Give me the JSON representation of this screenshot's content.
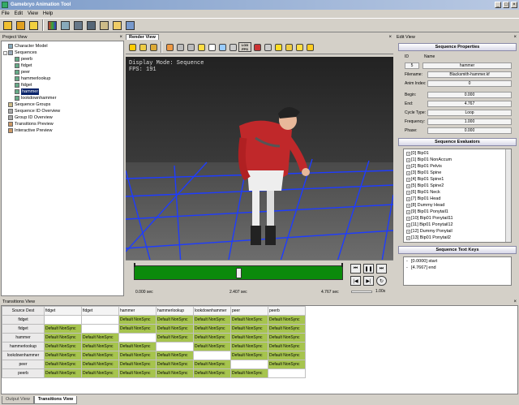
{
  "app": {
    "title": "Gamebryo Animation Tool"
  },
  "menu": [
    "File",
    "Edit",
    "View",
    "Help"
  ],
  "toolbar": {
    "icons": [
      "open-icon",
      "refresh-icon",
      "user-icon",
      "color-icon",
      "model-icon",
      "sequence-icon",
      "transition-icon",
      "group-icon",
      "options-icon",
      "view-icon"
    ]
  },
  "project_view": {
    "title": "Project View",
    "tree": [
      {
        "label": "Character Model",
        "level": 0,
        "icon": "model-icon"
      },
      {
        "label": "Sequences",
        "level": 0,
        "icon": "folder-icon"
      },
      {
        "label": "peerb",
        "level": 1,
        "icon": "sequence-icon"
      },
      {
        "label": "fidget",
        "level": 1,
        "icon": "sequence-icon"
      },
      {
        "label": "peer",
        "level": 1,
        "icon": "sequence-icon"
      },
      {
        "label": "hammerlookup",
        "level": 1,
        "icon": "sequence-icon"
      },
      {
        "label": "fidget",
        "level": 1,
        "icon": "sequence-icon"
      },
      {
        "label": "hammer",
        "level": 1,
        "icon": "sequence-icon",
        "selected": true
      },
      {
        "label": "lookdownhammer",
        "level": 1,
        "icon": "sequence-icon"
      },
      {
        "label": "Sequence Groups",
        "level": 0,
        "icon": "group-icon"
      },
      {
        "label": "Sequence ID Overview",
        "level": 0,
        "icon": "overview-icon"
      },
      {
        "label": "Group ID Overview",
        "level": 0,
        "icon": "overview-icon"
      },
      {
        "label": "Transitions Preview",
        "level": 0,
        "icon": "preview-icon"
      },
      {
        "label": "Interactive Preview",
        "level": 0,
        "icon": "preview-icon"
      }
    ]
  },
  "render_view": {
    "tab": "Render View",
    "overlay_line1": "Display Mode: Sequence",
    "overlay_line2": "FPS: 191",
    "fps_button": "LOD FPS",
    "timeline": {
      "start": "0.000 sec",
      "current": "2.407 sec",
      "end": "4.767 sec",
      "speed": "1.00x",
      "progress": 0.505
    }
  },
  "edit_view": {
    "title": "Edit View",
    "properties_header": "Sequence Properties",
    "id_label": "ID",
    "id_value": "5",
    "name_label": "Name",
    "name_value": "hammer",
    "filename_label": "Filename:",
    "filename_value": "Blacksmith-hammer.kf",
    "anim_index_label": "Anim Index:",
    "anim_index_value": "0",
    "begin_label": "Begin:",
    "begin_value": "0.000",
    "end_label": "End:",
    "end_value": "4.767",
    "cycle_label": "Cycle Type:",
    "cycle_value": "Loop",
    "freq_label": "Frequency:",
    "freq_value": "1.000",
    "phase_label": "Phase:",
    "phase_value": "0.000",
    "evaluators_header": "Sequence Evaluators",
    "evaluators": [
      "[0] Bip01",
      "[1] Bip01 NonAccum",
      "[2] Bip01 Pelvis",
      "[3] Bip01 Spine",
      "[4] Bip01 Spine1",
      "[5] Bip01 Spine2",
      "[6] Bip01 Neck",
      "[7] Bip01 Head",
      "[8] Dummy Head",
      "[9] Bip01 Ponytail1",
      "[10] Bip01 Ponytail11",
      "[11] Bip01 Ponytail12",
      "[12] Dummy Ponytail",
      "[13] Bip01 Ponytail2"
    ],
    "textkeys_header": "Sequence Text Keys",
    "textkeys": [
      "[0.0000] start",
      "[4.7667] end"
    ]
  },
  "transitions": {
    "title": "Transitions View",
    "corner_left": "Source",
    "corner_right": "Dest",
    "columns": [
      "fidget",
      "fidget",
      "hammer",
      "hammerlookup",
      "lookdownhammer",
      "peer",
      "peerb"
    ],
    "rows": [
      {
        "label": "fidget",
        "cells": [
          "",
          "",
          "Default NonSync",
          "Default NonSync",
          "Default NonSync",
          "Default NonSync",
          "Default NonSync"
        ]
      },
      {
        "label": "fidget",
        "cells": [
          "Default NonSync",
          "",
          "Default NonSync",
          "Default NonSync",
          "Default NonSync",
          "Default NonSync",
          "Default NonSync"
        ]
      },
      {
        "label": "hammer",
        "cells": [
          "Default NonSync",
          "Default NonSync",
          "",
          "Default NonSync",
          "Default NonSync",
          "Default NonSync",
          "Default NonSync"
        ]
      },
      {
        "label": "hammerlookup",
        "cells": [
          "Default NonSync",
          "Default NonSync",
          "Default NonSync",
          "",
          "Default NonSync",
          "Default NonSync",
          "Default NonSync"
        ]
      },
      {
        "label": "lookdownhammer",
        "cells": [
          "Default NonSync",
          "Default NonSync",
          "Default NonSync",
          "Default NonSync",
          "",
          "Default NonSync",
          "Default NonSync"
        ]
      },
      {
        "label": "peer",
        "cells": [
          "Default NonSync",
          "Default NonSync",
          "Default NonSync",
          "Default NonSync",
          "Default NonSync",
          "",
          "Default NonSync"
        ]
      },
      {
        "label": "peerb",
        "cells": [
          "Default NonSync",
          "Default NonSync",
          "Default NonSync",
          "Default NonSync",
          "Default NonSync",
          "Default NonSync",
          ""
        ]
      }
    ]
  },
  "bottom_tabs": [
    "Output View",
    "Transitions View"
  ]
}
